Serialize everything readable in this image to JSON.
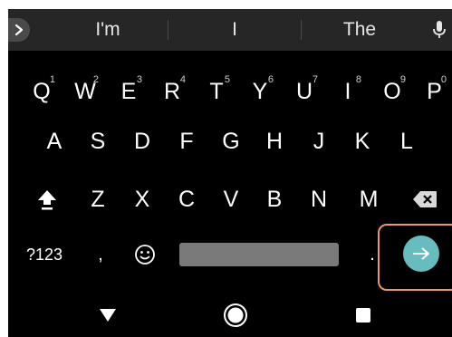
{
  "suggestion_bar": {
    "suggestions": [
      "I'm",
      "I",
      "The"
    ],
    "expand_icon": "chevron-right-icon",
    "mic_icon": "microphone-icon"
  },
  "keyboard": {
    "row1": [
      {
        "label": "Q",
        "hint": "1"
      },
      {
        "label": "W",
        "hint": "2"
      },
      {
        "label": "E",
        "hint": "3"
      },
      {
        "label": "R",
        "hint": "4"
      },
      {
        "label": "T",
        "hint": "5"
      },
      {
        "label": "Y",
        "hint": "6"
      },
      {
        "label": "U",
        "hint": "7"
      },
      {
        "label": "I",
        "hint": "8"
      },
      {
        "label": "O",
        "hint": "9"
      },
      {
        "label": "P",
        "hint": "0"
      }
    ],
    "row2": [
      "A",
      "S",
      "D",
      "F",
      "G",
      "H",
      "J",
      "K",
      "L"
    ],
    "row3": [
      "Z",
      "X",
      "C",
      "V",
      "B",
      "N",
      "M"
    ],
    "shift_icon": "shift-icon",
    "backspace_icon": "backspace-icon",
    "symbols_label": "?123",
    "comma_label": ",",
    "emoji_icon": "smiley-icon",
    "period_label": ".",
    "enter_icon": "arrow-right-icon",
    "colors": {
      "background": "#000000",
      "suggestion_bar": "#262626",
      "key_text": "#ffffff",
      "space_bar": "#7a7a7a",
      "enter_button": "#66bcbf",
      "highlight_outline": "#e8986a"
    }
  },
  "nav_bar": {
    "back_icon": "back-triangle-icon",
    "home_icon": "home-circle-icon",
    "recents_icon": "recents-square-icon"
  }
}
